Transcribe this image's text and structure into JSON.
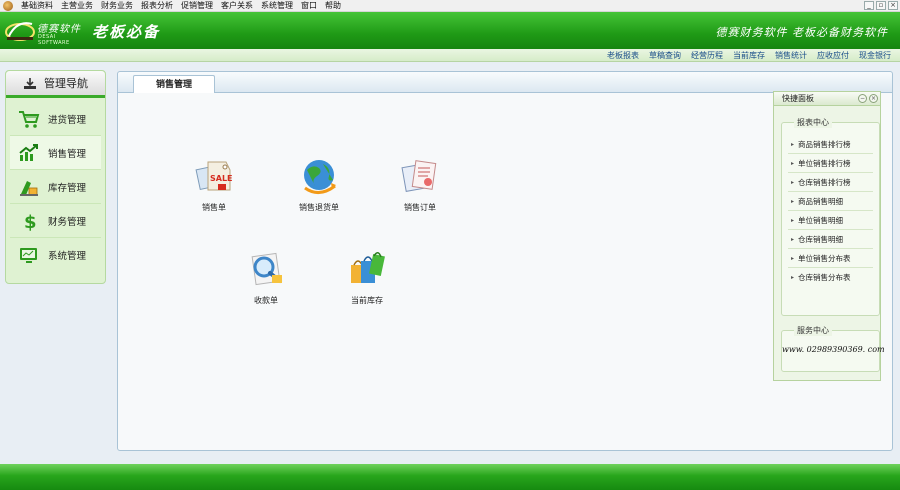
{
  "menu": [
    "基础资料",
    "主营业务",
    "财务业务",
    "报表分析",
    "促销管理",
    "客户关系",
    "系统管理",
    "窗口",
    "帮助"
  ],
  "window_controls": [
    "_",
    "▫",
    "×"
  ],
  "header": {
    "logo_cn": "德赛软件",
    "logo_en": "DESAI SOFTWARE",
    "slogan": "老板必备",
    "right_slogan": "德赛财务软件  老板必备财务软件"
  },
  "quick_links": [
    "老板报表",
    "草稿查询",
    "经营历程",
    "当前库存",
    "销售统计",
    "应收应付",
    "现金银行"
  ],
  "nav": {
    "title": "管理导航",
    "items": [
      {
        "label": "进货管理",
        "icon": "shopping-cart-icon"
      },
      {
        "label": "销售管理",
        "icon": "trend-chart-icon"
      },
      {
        "label": "库存管理",
        "icon": "inventory-icon"
      },
      {
        "label": "财务管理",
        "icon": "dollar-icon"
      },
      {
        "label": "系统管理",
        "icon": "monitor-icon"
      }
    ],
    "active_index": 1
  },
  "main": {
    "tab": "销售管理",
    "functions": [
      {
        "label": "销售单",
        "icon": "sale-tag-icon"
      },
      {
        "label": "销售退货单",
        "icon": "globe-return-icon"
      },
      {
        "label": "销售订单",
        "icon": "order-docs-icon"
      },
      {
        "label": "收款单",
        "icon": "magnifier-receipt-icon"
      },
      {
        "label": "当前库存",
        "icon": "shopping-bags-icon"
      }
    ]
  },
  "quick_panel": {
    "title": "快捷面板",
    "report_center": {
      "title": "报表中心",
      "items": [
        "商品销售排行榜",
        "单位销售排行榜",
        "仓库销售排行榜",
        "商品销售明细",
        "单位销售明细",
        "仓库销售明细",
        "单位销售分布表",
        "仓库销售分布表"
      ]
    },
    "service_center": {
      "title": "服务中心",
      "phone": "www. 02989390369. com"
    }
  },
  "colors": {
    "header_green": "#1f9a16",
    "link_blue": "#1a4e8a",
    "panel_border": "#a9c3d6"
  }
}
